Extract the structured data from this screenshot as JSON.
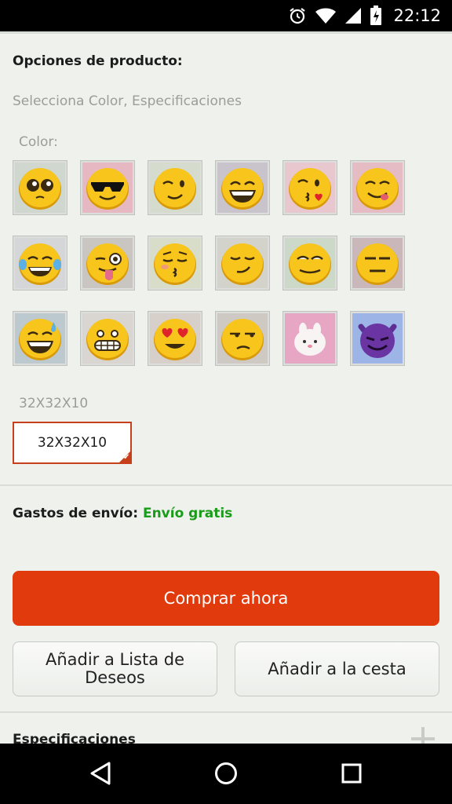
{
  "status_bar": {
    "time": "22:12",
    "icons": [
      "alarm-icon",
      "wifi-icon",
      "signal-icon",
      "battery-icon"
    ]
  },
  "product_options": {
    "title": "Opciones de producto:",
    "hint": "Selecciona Color, Especificaciones",
    "color_label": "Color:",
    "colors": [
      "pleading",
      "sunglasses",
      "wink",
      "grin",
      "kiss",
      "yum",
      "tears-of-joy",
      "tongue-wink",
      "kiss-blush",
      "smirk",
      "squint-smirk",
      "expressionless",
      "sweat-smile",
      "grimace",
      "heart-eyes",
      "unamused",
      "white-bunny",
      "purple-devil"
    ],
    "size_label": "32X32X10",
    "size_option": "32X32X10"
  },
  "shipping": {
    "label": "Gastos de envío:",
    "value": "Envío gratis",
    "value_color": "#1a9b1a"
  },
  "actions": {
    "buy_now": "Comprar ahora",
    "wishlist": "Añadir a Lista de Deseos",
    "add_to_cart": "Añadir a la cesta",
    "buy_color": "#e03a0d"
  },
  "specs": {
    "title": "Especificaciones"
  },
  "nav_bar": {
    "icons": [
      "back-icon",
      "home-icon",
      "recents-icon"
    ]
  }
}
